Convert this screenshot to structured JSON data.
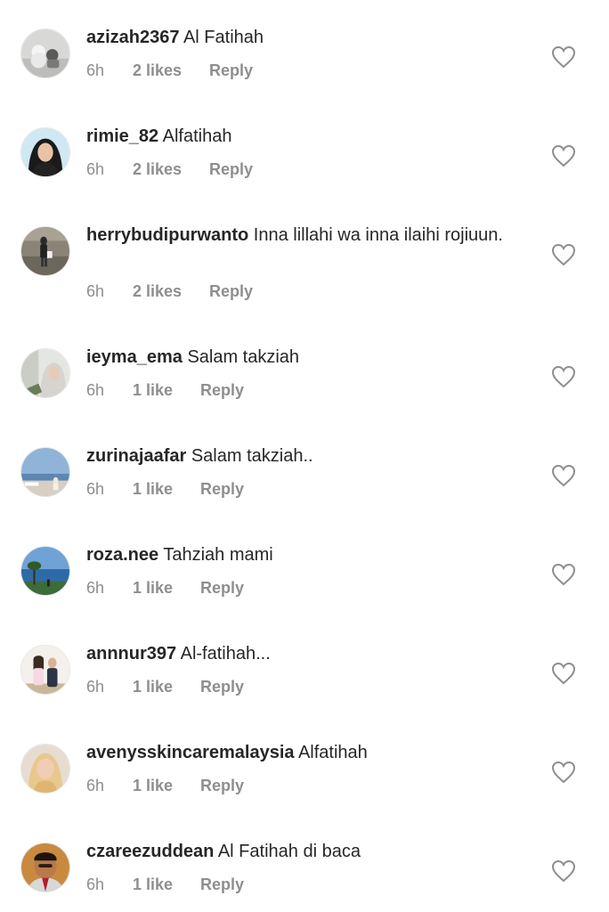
{
  "comments": [
    {
      "username": "azizah2367",
      "text": "Al Fatihah",
      "time": "6h",
      "likes": "2 likes",
      "reply": "Reply",
      "avatar": "avatar-toys"
    },
    {
      "username": "rimie_82",
      "text": "Alfatihah",
      "time": "6h",
      "likes": "2 likes",
      "reply": "Reply",
      "avatar": "avatar-woman-hijab-black"
    },
    {
      "username": "herrybudipurwanto",
      "text": "Inna lillahi wa inna ilaihi rojiuun.",
      "time": "6h",
      "likes": "2 likes",
      "reply": "Reply",
      "avatar": "avatar-walking-man"
    },
    {
      "username": "ieyma_ema",
      "text": "Salam takziah",
      "time": "6h",
      "likes": "1 like",
      "reply": "Reply",
      "avatar": "avatar-woman-hijab-grey"
    },
    {
      "username": "zurinajaafar",
      "text": "Salam takziah..",
      "time": "6h",
      "likes": "1 like",
      "reply": "Reply",
      "avatar": "avatar-beach"
    },
    {
      "username": "roza.nee",
      "text": "Tahziah mami",
      "time": "6h",
      "likes": "1 like",
      "reply": "Reply",
      "avatar": "avatar-seaside-tree"
    },
    {
      "username": "annnur397",
      "text": "Al-fatihah...",
      "time": "6h",
      "likes": "1 like",
      "reply": "Reply",
      "avatar": "avatar-couple"
    },
    {
      "username": "avenysskincaremalaysia",
      "text": "Alfatihah",
      "time": "6h",
      "likes": "1 like",
      "reply": "Reply",
      "avatar": "avatar-woman-hijab-beige"
    },
    {
      "username": "czareezuddean",
      "text": "Al Fatihah di baca",
      "time": "6h",
      "likes": "1 like",
      "reply": "Reply",
      "avatar": "avatar-man-portrait"
    }
  ],
  "colors": {
    "text": "#262626",
    "meta": "#8e8e8e",
    "heart": "#8e8e8e"
  }
}
